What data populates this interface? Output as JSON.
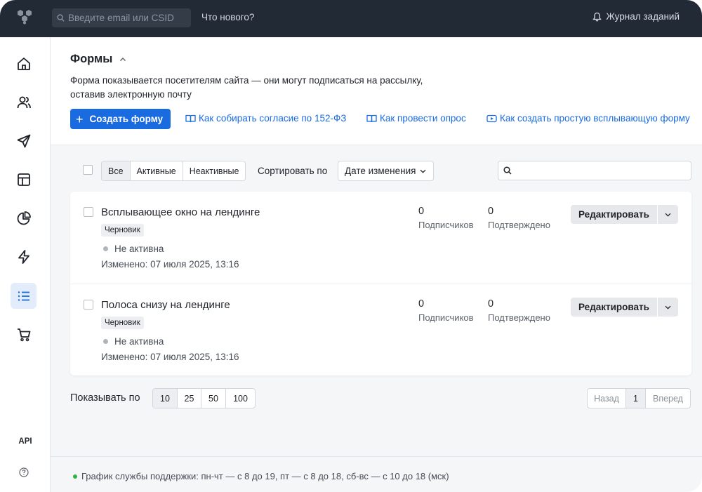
{
  "topbar": {
    "search_placeholder": "Введите email или CSID",
    "whats_new": "Что нового?",
    "journal": "Журнал заданий"
  },
  "sidebar": {
    "items": [
      {
        "icon": "home-icon"
      },
      {
        "icon": "users-icon"
      },
      {
        "icon": "send-icon"
      },
      {
        "icon": "layout-icon"
      },
      {
        "icon": "pie-chart-icon"
      },
      {
        "icon": "lightning-icon"
      },
      {
        "icon": "list-icon",
        "active": true
      },
      {
        "icon": "cart-icon"
      }
    ],
    "api_label": "API"
  },
  "header": {
    "title": "Формы",
    "description": "Форма показывается посетителям сайта — они могут подписаться на рассылку, оставив электронную почту",
    "create_button": "Создать форму",
    "links": [
      "Как собирать согласие по 152-ФЗ",
      "Как провести опрос",
      "Как создать простую всплывающую форму"
    ]
  },
  "filters": {
    "tabs": [
      "Все",
      "Активные",
      "Неактивные"
    ],
    "selected_tab": "Все",
    "sort_label": "Сортировать по",
    "sort_value": "Дате изменения",
    "search_value": ""
  },
  "forms": [
    {
      "name": "Всплывающее окно на лендинге",
      "badge": "Черновик",
      "status": "Не активна",
      "changed": "Изменено: 07 июля 2025, 13:16",
      "subscribers": "0",
      "subscribers_label": "Подписчиков",
      "confirmed": "0",
      "confirmed_label": "Подтверждено",
      "edit_label": "Редактировать"
    },
    {
      "name": "Полоса снизу на лендинге",
      "badge": "Черновик",
      "status": "Не активна",
      "changed": "Изменено: 07 июля 2025, 13:16",
      "subscribers": "0",
      "subscribers_label": "Подписчиков",
      "confirmed": "0",
      "confirmed_label": "Подтверждено",
      "edit_label": "Редактировать"
    }
  ],
  "pagination": {
    "show_label": "Показывать по",
    "page_sizes": [
      "10",
      "25",
      "50",
      "100"
    ],
    "selected_size": "10",
    "prev": "Назад",
    "current": "1",
    "next": "Вперед"
  },
  "footer": {
    "support": "График службы поддержки: пн-чт — с 8 до 19, пт — с 8 до 18, сб-вс — с 10 до 18 (мск)"
  },
  "colors": {
    "topbar_bg": "#222a36",
    "accent": "#1a6be0",
    "active_nav_bg": "#e2ecfb",
    "support_dot": "#2fb344"
  }
}
